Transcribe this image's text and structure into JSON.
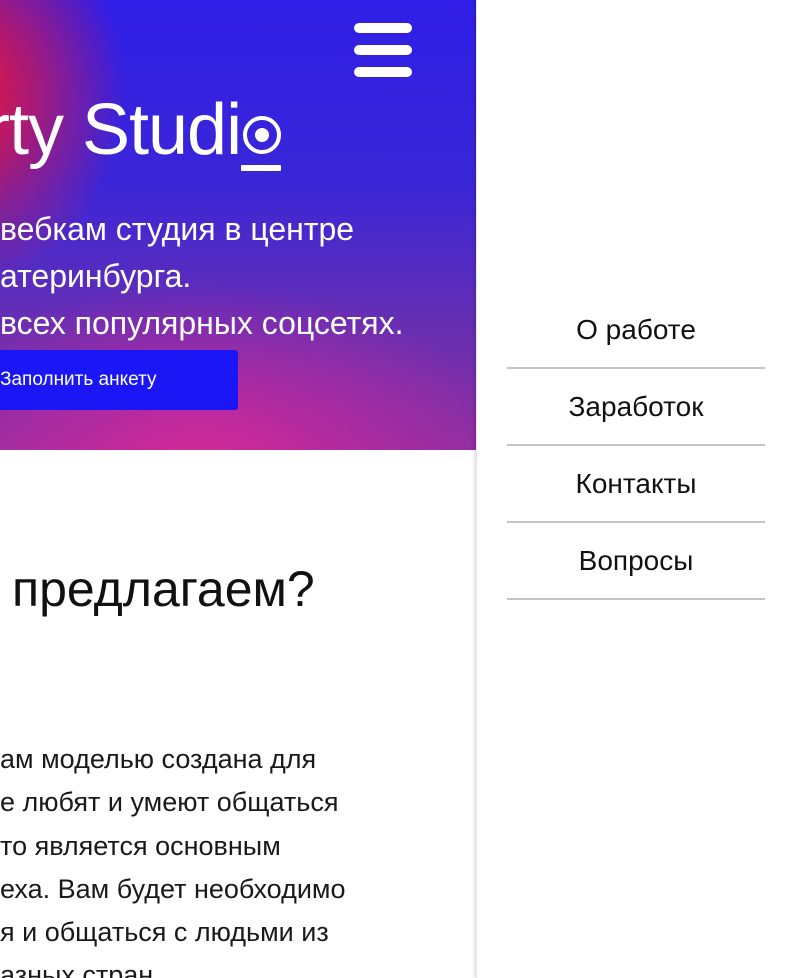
{
  "hero": {
    "brand_text": "rty Studi",
    "brand_last_letter": "o",
    "tagline_lines": [
      " вебкам студия в центре",
      "атеринбурга.",
      "всех популярных соцсетях."
    ],
    "cta_label": "Заполнить анкету",
    "menu_icon": "hamburger-menu-icon",
    "colors": {
      "gradient_start": "#ff1428",
      "gradient_mid": "#2f1ee6",
      "gradient_end": "#c83aa0",
      "cta_background": "#1a16f5"
    }
  },
  "section": {
    "heading": "предлагаем?",
    "paragraph_lines": [
      "ам моделью создана для",
      "е любят и умеют общаться",
      "то является основным",
      "еха. Вам будет необходимо",
      "я и общаться с людьми из",
      "азных стран"
    ]
  },
  "nav_drawer": {
    "items": [
      {
        "label": "О работе"
      },
      {
        "label": "Заработок"
      },
      {
        "label": "Контакты"
      },
      {
        "label": "Вопросы"
      }
    ]
  }
}
